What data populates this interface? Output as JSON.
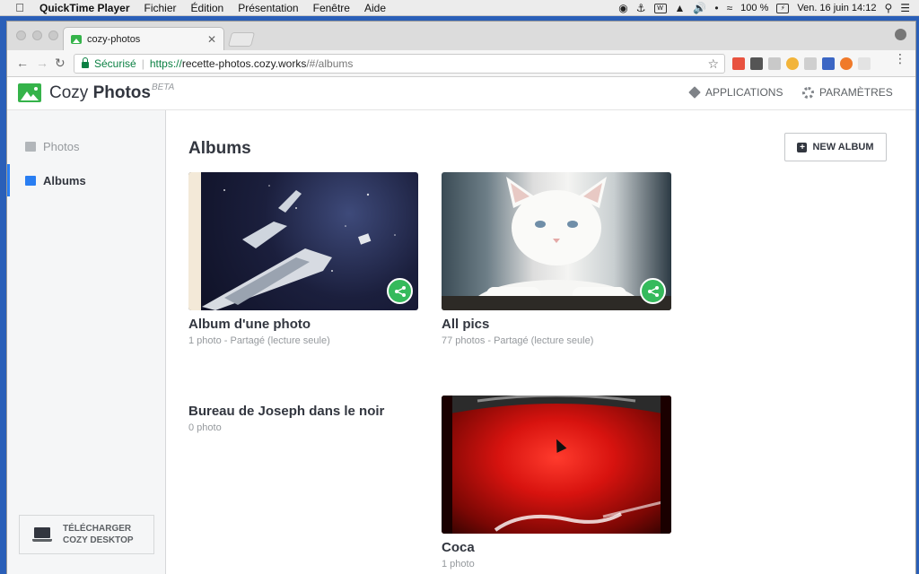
{
  "menubar": {
    "app_name": "QuickTime Player",
    "menus": [
      "Fichier",
      "Édition",
      "Présentation",
      "Fenêtre",
      "Aide"
    ],
    "battery": "100 %",
    "datetime": "Ven. 16 juin  14:12"
  },
  "browser": {
    "tab_title": "cozy-photos",
    "secure_label": "Sécurisé",
    "url_scheme": "https://",
    "url_host": "recette-photos.cozy.works",
    "url_path": "/#/albums"
  },
  "header": {
    "brand_light": "Cozy ",
    "brand_bold": "Photos",
    "beta": "BETA",
    "applications": "APPLICATIONS",
    "settings": "PARAMÈTRES"
  },
  "sidebar": {
    "items": [
      {
        "label": "Photos",
        "icon": "image-icon",
        "active": false
      },
      {
        "label": "Albums",
        "icon": "album-icon",
        "active": true
      }
    ],
    "download_line1": "TÉLÉCHARGER",
    "download_line2": "COZY DESKTOP"
  },
  "main": {
    "title": "Albums",
    "new_album": "NEW ALBUM",
    "albums": [
      {
        "name": "Album d'une photo",
        "meta": "1 photo - Partagé (lecture seule)",
        "shared": true,
        "cover": "space-shuttle"
      },
      {
        "name": "All pics",
        "meta": "77 photos - Partagé (lecture seule)",
        "shared": true,
        "cover": "white-cat"
      },
      {
        "name": "Bureau de Joseph dans le noir",
        "meta": "0 photo",
        "shared": false,
        "cover": null
      },
      {
        "name": "Coca",
        "meta": "1 photo",
        "shared": false,
        "cover": "coca-can"
      }
    ]
  },
  "colors": {
    "accent": "#297ef2",
    "brand_green": "#35b34a",
    "share_green": "#35ba5c",
    "text_dark": "#32363f",
    "text_muted": "#95999d"
  }
}
